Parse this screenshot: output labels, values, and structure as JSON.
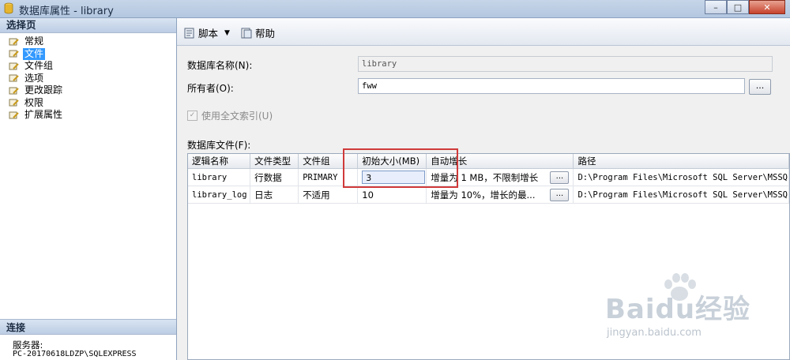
{
  "window": {
    "title": "数据库属性 - library",
    "buttons": [
      "–",
      "□",
      "✕"
    ]
  },
  "left_panel": {
    "header": "选择页",
    "items": [
      {
        "label": "常规",
        "selected": false
      },
      {
        "label": "文件",
        "selected": true
      },
      {
        "label": "文件组",
        "selected": false
      },
      {
        "label": "选项",
        "selected": false
      },
      {
        "label": "更改跟踪",
        "selected": false
      },
      {
        "label": "权限",
        "selected": false
      },
      {
        "label": "扩展属性",
        "selected": false
      }
    ],
    "connection": {
      "header": "连接",
      "server_label": "服务器:",
      "server_value": "PC-20170618LDZP\\SQLEXPRESS"
    }
  },
  "toolbar": {
    "script_label": "脚本",
    "help_label": "帮助"
  },
  "form": {
    "db_name_label": "数据库名称(N):",
    "db_name_value": "library",
    "owner_label": "所有者(O):",
    "owner_value": "fww",
    "ellipsis": "...",
    "fulltext_label": "使用全文索引(U)",
    "fulltext_checked": true,
    "files_label": "数据库文件(F):"
  },
  "files_table": {
    "columns": [
      "逻辑名称",
      "文件类型",
      "文件组",
      "初始大小(MB)",
      "自动增长",
      "路径"
    ],
    "rows": [
      [
        "library",
        "行数据",
        "PRIMARY",
        "3",
        "增量为 1 MB，不限制增长",
        "D:\\Program Files\\Microsoft SQL Server\\MSSQ"
      ],
      [
        "library_log",
        "日志",
        "不适用",
        "10",
        "增量为 10%，增长的最...",
        "D:\\Program Files\\Microsoft SQL Server\\MSSQ"
      ]
    ],
    "ellipsis": "..."
  },
  "watermark": {
    "brand": "Baidu经验",
    "url": "jingyan.baidu.com"
  },
  "colors": {
    "selection": "#3399ff",
    "highlight_box": "#d03a3a",
    "panel_header": "#bccde4"
  }
}
